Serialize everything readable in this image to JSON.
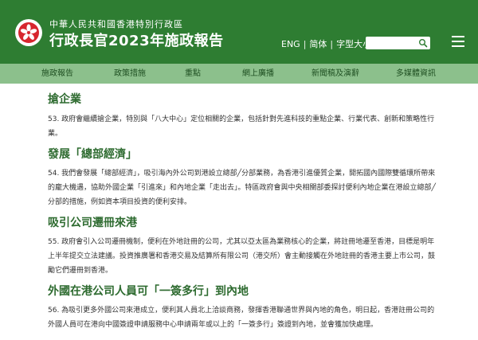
{
  "header": {
    "govt_name": "中華人民共和國香港特別行政區",
    "report_title": "行政長官2023年施政報告",
    "lang_eng": "ENG",
    "lang_sc": "简体",
    "font_size": "字型大小",
    "search_placeholder": "",
    "icons": [
      "hksar-emblem-icon",
      "search-icon",
      "menu-icon"
    ]
  },
  "nav": {
    "items": [
      {
        "label": "施政報告"
      },
      {
        "label": "政策措施"
      },
      {
        "label": "重點"
      },
      {
        "label": "網上廣播"
      },
      {
        "label": "新聞稿及演辭"
      },
      {
        "label": "多媒體資訊"
      }
    ]
  },
  "sections": [
    {
      "title": "搶企業",
      "text": "53. 政府會繼續搶企業，特別與「八大中心」定位相關的企業，包括針對先進科技的重點企業、行業代表、創新和策略性行業。"
    },
    {
      "title": "發展「總部經濟」",
      "text": "54. 我們會發展「總部經濟」，吸引海內外公司到港設立總部╱分部業務，為香港引進優質企業，開拓國內國際雙循環所帶來的龐大機遇，協助外國企業「引進來」和內地企業「走出去」。特區政府會與中央相關部委探討便利內地企業在港設立總部╱分部的措施，例如資本項目投資的便利安排。"
    },
    {
      "title": "吸引公司遷冊來港",
      "text": "55. 政府會引入公司遷冊機制，便利在外地註冊的公司，尤其以亞太區為業務核心的企業，將註冊地遷至香港，目標是明年上半年提交立法建議。投資推廣署和香港交易及結算所有限公司（港交所）會主動接觸在外地註冊的香港主要上市公司，鼓勵它們遷冊到香港。"
    },
    {
      "title": "外國在港公司人員可「一簽多行」到內地",
      "text": "56. 為吸引更多外國公司來港成立，便利其人員北上洽談商務，發揮香港聯通世界與內地的角色，明日起，香港註冊公司的外國人員可在港向中國簽證申請服務中心申請兩年或以上的「一簽多行」簽證到內地，並會獲加快處理。"
    }
  ],
  "colors": {
    "header_bg": "#2e7d32",
    "nav_bg": "#8cc08c",
    "section_title": "#2e6b30",
    "emblem_red": "#d7262e"
  }
}
